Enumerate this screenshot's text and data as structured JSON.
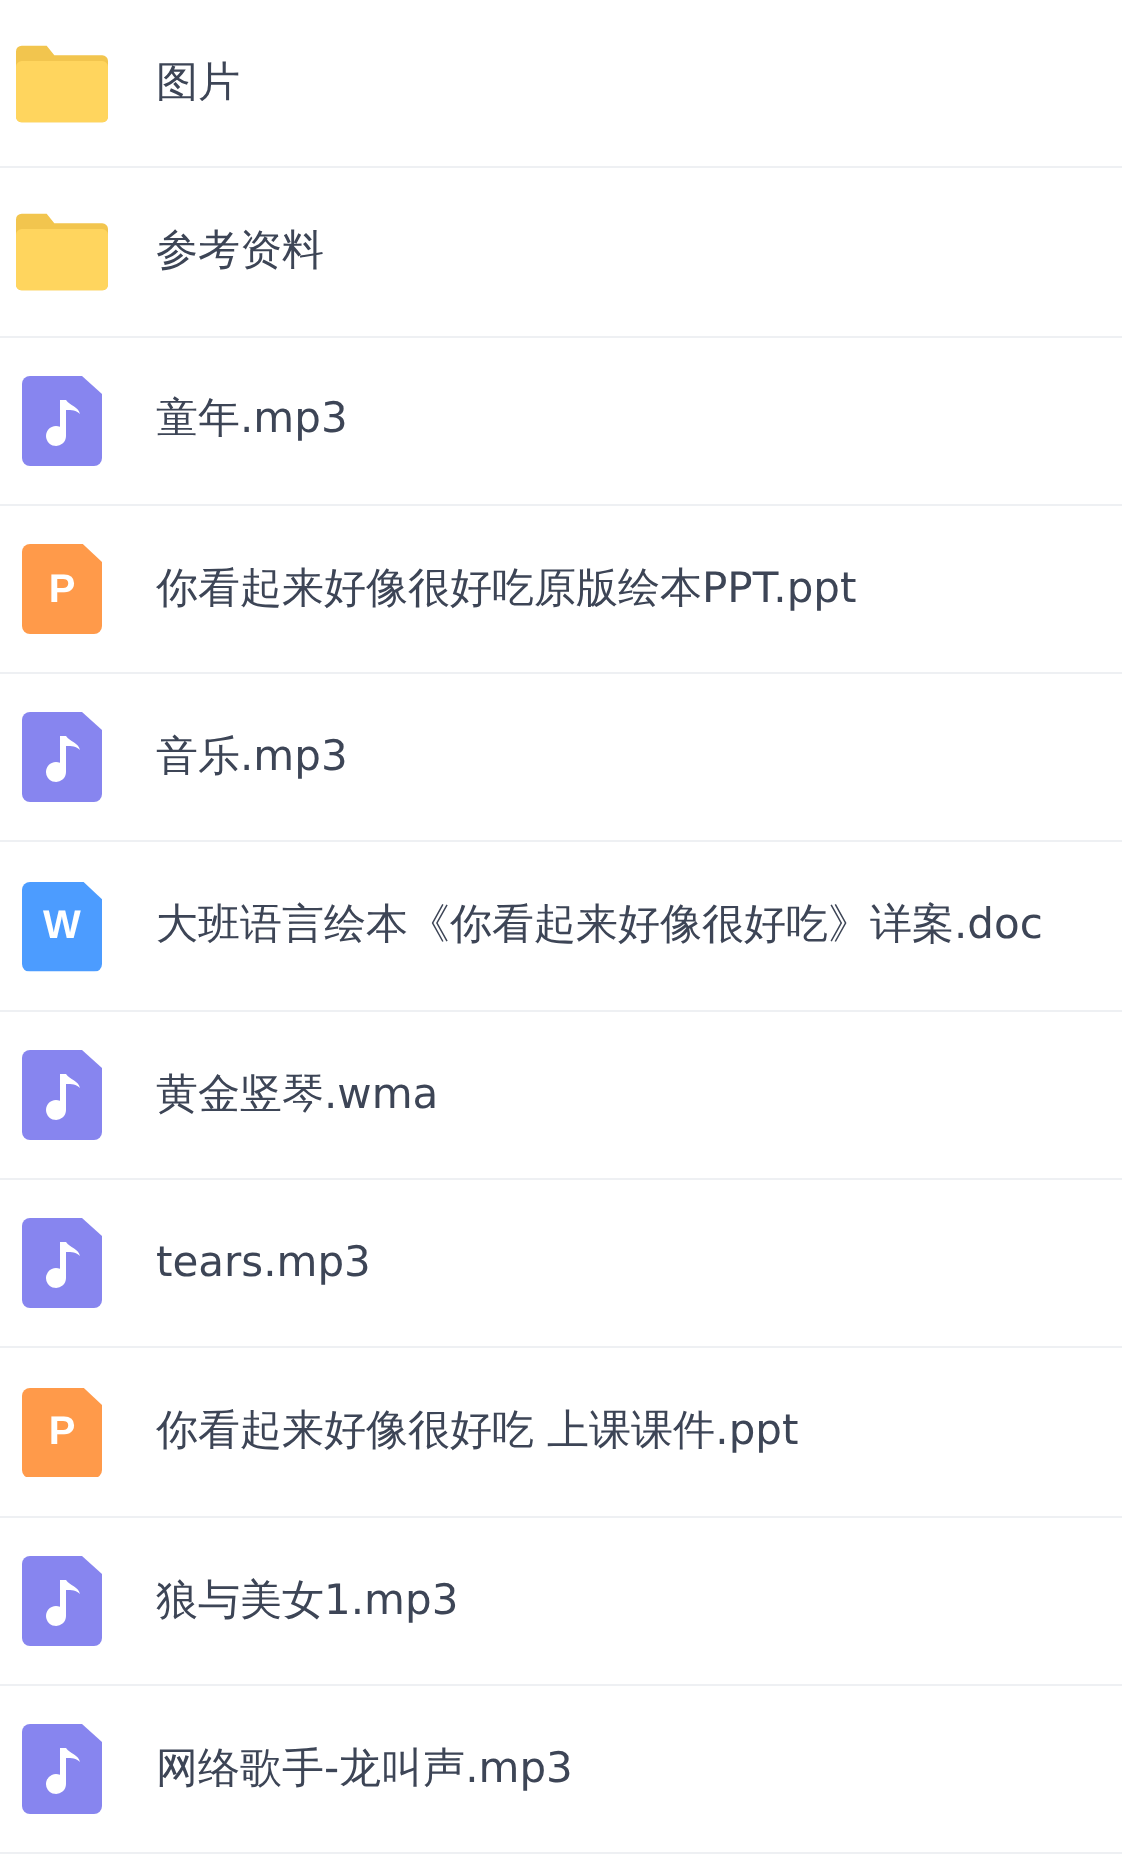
{
  "files": [
    {
      "kind": "folder",
      "name": "图片"
    },
    {
      "kind": "folder",
      "name": "参考资料"
    },
    {
      "kind": "audio",
      "name": "童年.mp3"
    },
    {
      "kind": "ppt",
      "name": "你看起来好像很好吃原版绘本PPT.ppt",
      "letter": "P"
    },
    {
      "kind": "audio",
      "name": "音乐.mp3"
    },
    {
      "kind": "doc",
      "name": "大班语言绘本《你看起来好像很好吃》详案.doc",
      "letter": "W"
    },
    {
      "kind": "audio",
      "name": "黄金竖琴.wma"
    },
    {
      "kind": "audio",
      "name": "tears.mp3"
    },
    {
      "kind": "ppt",
      "name": "你看起来好像很好吃 上课课件.ppt",
      "letter": "P"
    },
    {
      "kind": "audio",
      "name": "狼与美女1.mp3"
    },
    {
      "kind": "audio",
      "name": "网络歌手-龙叫声.mp3"
    }
  ]
}
